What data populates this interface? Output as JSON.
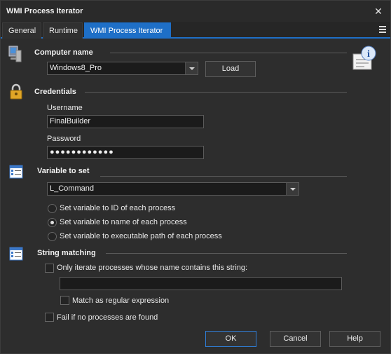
{
  "window": {
    "title": "WMI Process Iterator",
    "close_label": "✕"
  },
  "tabs": [
    {
      "label": "General"
    },
    {
      "label": "Runtime"
    },
    {
      "label": "WMI Process Iterator"
    }
  ],
  "computer": {
    "section_title": "Computer name",
    "value": "Windows8_Pro",
    "load_label": "Load"
  },
  "credentials": {
    "section_title": "Credentials",
    "username_label": "Username",
    "username_value": "FinalBuilder",
    "password_label": "Password",
    "password_value": "●●●●●●●●●●●●"
  },
  "variable": {
    "section_title": "Variable to set",
    "selected": "L_Command",
    "options": [
      {
        "label": "Set variable to ID of each process",
        "checked": false
      },
      {
        "label": "Set variable to name of each process",
        "checked": true
      },
      {
        "label": "Set variable to executable path of each process",
        "checked": false
      }
    ]
  },
  "matching": {
    "section_title": "String matching",
    "only_iterate_label": "Only iterate processes whose name contains this string:",
    "only_iterate_checked": false,
    "match_string_value": "",
    "regex_label": "Match as regular expression",
    "regex_checked": false
  },
  "fail": {
    "label": "Fail if no processes are found",
    "checked": false
  },
  "buttons": {
    "ok": "OK",
    "cancel": "Cancel",
    "help": "Help"
  },
  "colors": {
    "accent": "#1e6fc7",
    "background": "#2d2d2d"
  }
}
